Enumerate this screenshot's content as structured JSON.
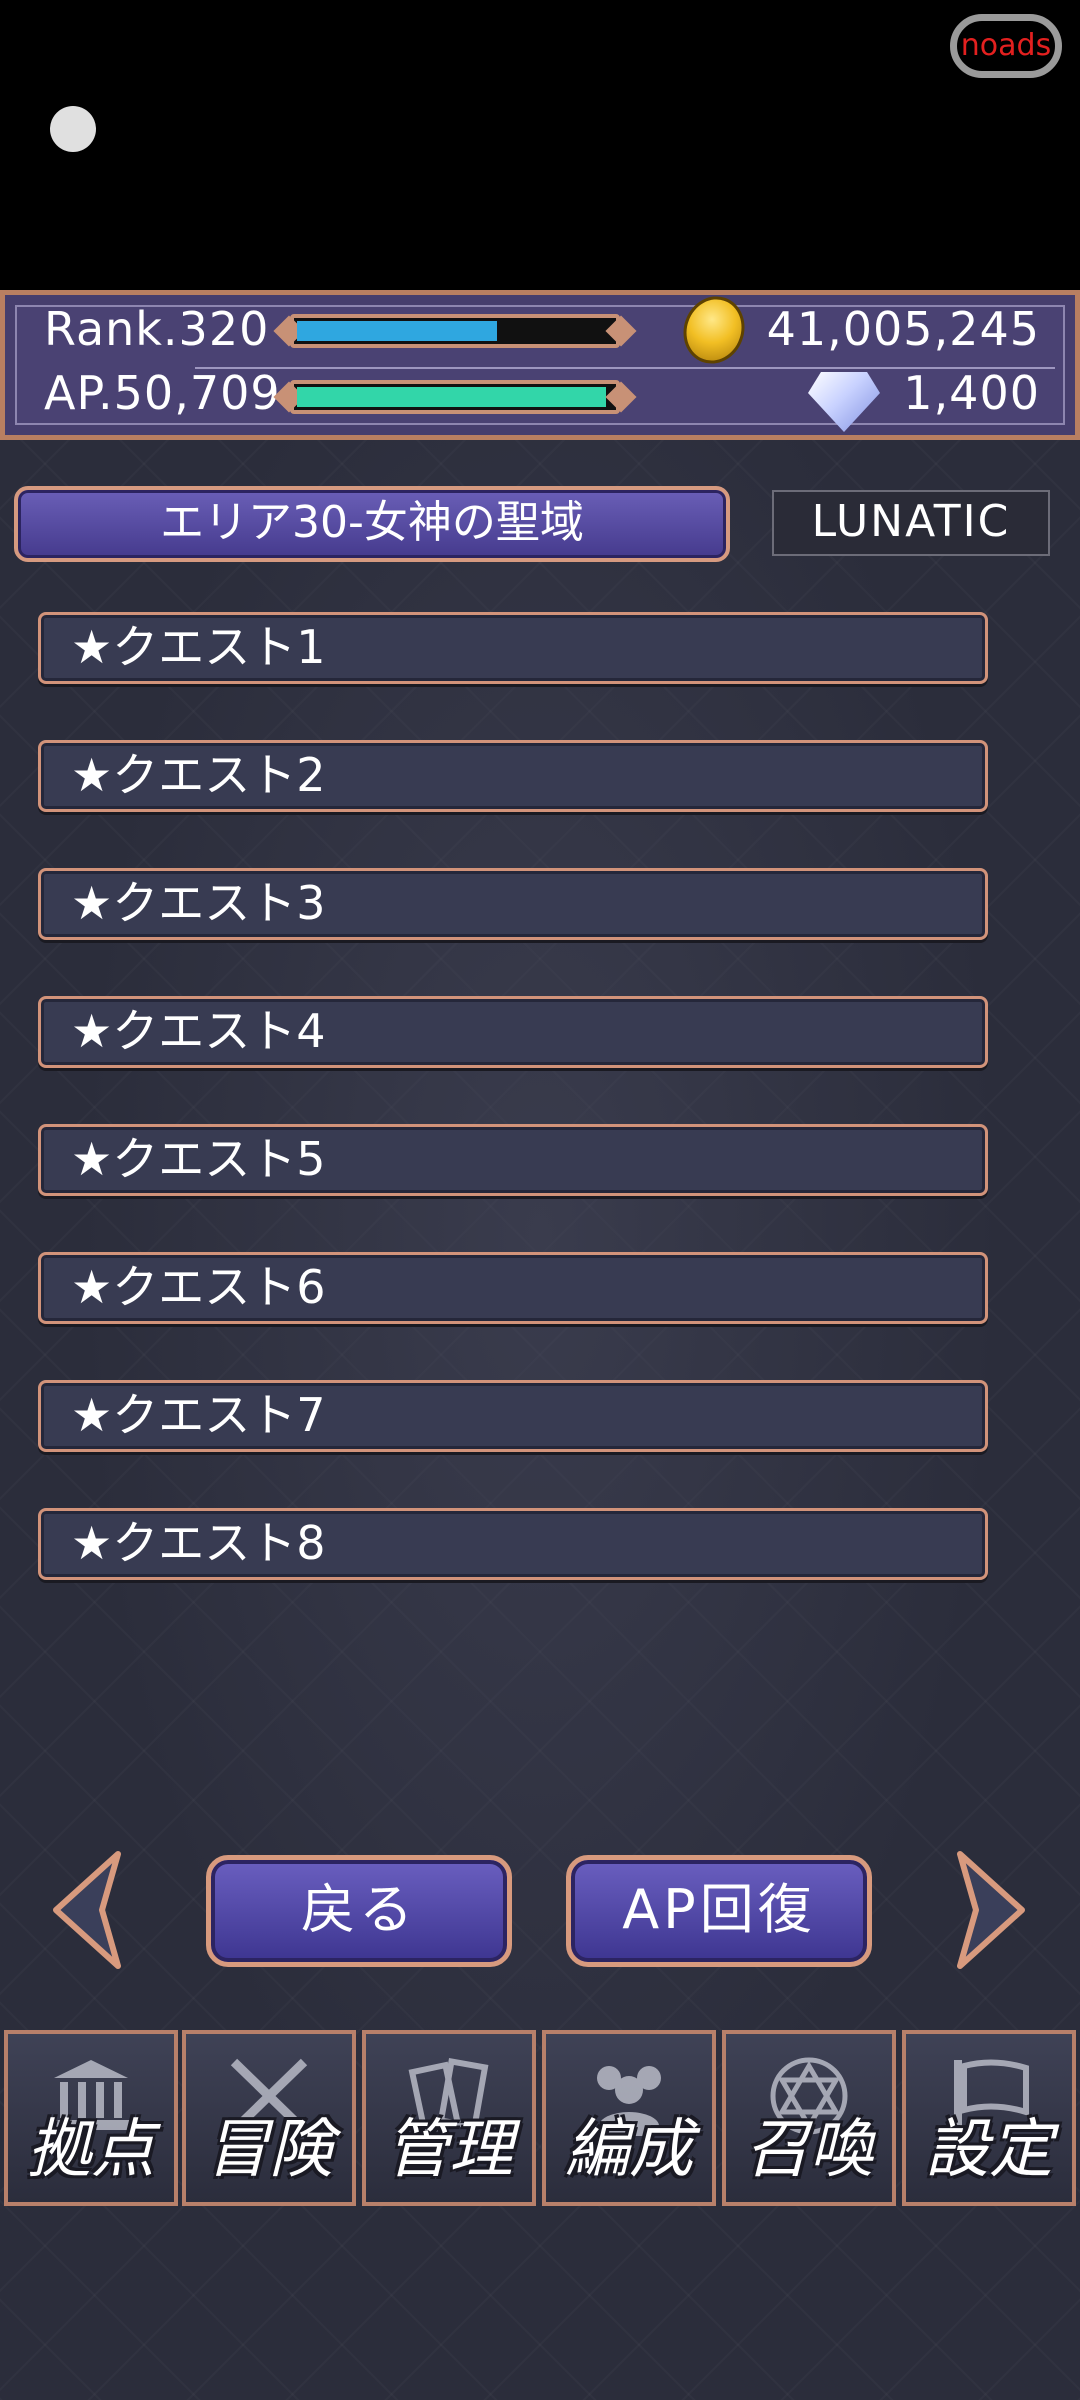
{
  "ads": {
    "label": "noads"
  },
  "status": {
    "rank_label": "Rank.320",
    "ap_label": "AP.50,709",
    "rank_progress": 0.62,
    "ap_progress": 0.98,
    "gold": "41,005,245",
    "gems": "1,400",
    "rank_bar_color": "#2fa7e0",
    "ap_bar_color": "#32d6a9"
  },
  "area": {
    "title": "エリア30-女神の聖域",
    "difficulty": "LUNATIC"
  },
  "quests": [
    {
      "label": "★クエスト1"
    },
    {
      "label": "★クエスト2"
    },
    {
      "label": "★クエスト3"
    },
    {
      "label": "★クエスト4"
    },
    {
      "label": "★クエスト5"
    },
    {
      "label": "★クエスト6"
    },
    {
      "label": "★クエスト7"
    },
    {
      "label": "★クエスト8"
    }
  ],
  "controls": {
    "back_label": "戻る",
    "ap_recover_label": "AP回復"
  },
  "bottom_nav": [
    {
      "label": "拠点",
      "icon": "bank-icon"
    },
    {
      "label": "冒険",
      "icon": "crossed-swords-icon"
    },
    {
      "label": "管理",
      "icon": "cards-icon"
    },
    {
      "label": "編成",
      "icon": "group-icon"
    },
    {
      "label": "召喚",
      "icon": "hexagram-icon"
    },
    {
      "label": "設定",
      "icon": "flag-icon"
    }
  ]
}
